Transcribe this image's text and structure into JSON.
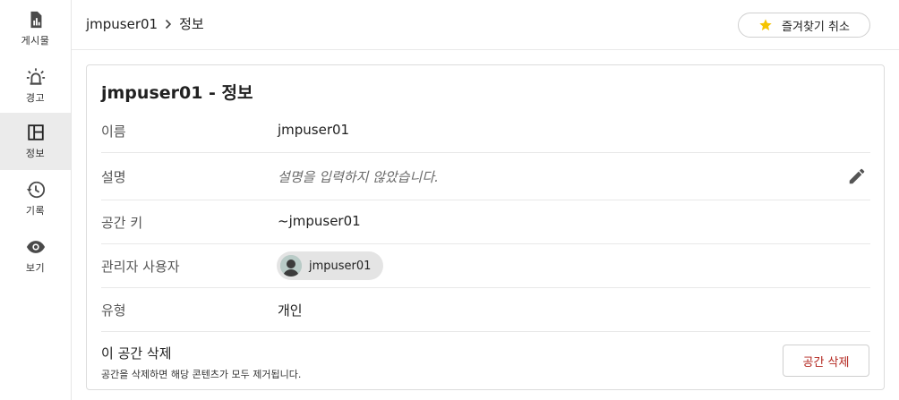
{
  "sidebar": {
    "items": [
      {
        "label": "게시물",
        "icon": "chart-document-icon"
      },
      {
        "label": "경고",
        "icon": "alarm-light-icon"
      },
      {
        "label": "정보",
        "icon": "layout-panel-icon",
        "active": true
      },
      {
        "label": "기록",
        "icon": "history-icon"
      },
      {
        "label": "보기",
        "icon": "eye-icon"
      }
    ]
  },
  "header": {
    "breadcrumb": [
      "jmpuser01",
      "정보"
    ],
    "favorite_button": "즐겨찾기 취소",
    "favorite_icon": "star-icon",
    "star_color": "#f5c400"
  },
  "info": {
    "title": "jmpuser01 - 정보",
    "rows": [
      {
        "label": "이름",
        "value": "jmpuser01"
      },
      {
        "label": "설명",
        "value": "설명을 입력하지 않았습니다."
      },
      {
        "label": "공간 키",
        "value": "~jmpuser01"
      },
      {
        "label": "관리자 사용자",
        "value": "jmpuser01"
      },
      {
        "label": "유형",
        "value": "개인"
      }
    ],
    "delete_section": {
      "title": "이 공간 삭제",
      "description": "공간을 삭제하면 해당 콘텐츠가 모두 제거됩니다.",
      "button": "공간 삭제",
      "button_color": "#b3261e"
    }
  }
}
